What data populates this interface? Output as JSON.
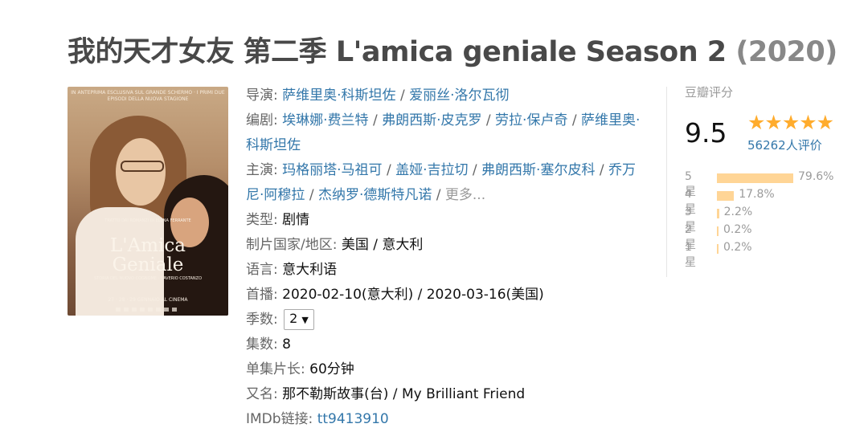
{
  "title": {
    "main": "我的天才女友 第二季 L'amica geniale Season 2",
    "year": "(2020)"
  },
  "poster": {
    "top_text": "IN ANTEPRIMA ESCLUSIVA SUL GRANDE SCHERMO · I PRIMI DUE EPISODI DELLA NUOVA STAGIONE",
    "author_text": "TRATTO DAI ROMANZI DI ELENA FERRANTE",
    "title_line1": "L'Amica",
    "title_line2": "Geniale",
    "subtitle": "STORIA DEL NUOVO COGNOME · SAVERIO COSTANZO",
    "dates": "27 · 28 · 29 GENNAIO AL CINEMA"
  },
  "info": {
    "director": {
      "label": "导演",
      "names": [
        "萨维里奥·科斯坦佐",
        "爱丽丝·洛尔瓦彻"
      ]
    },
    "writer": {
      "label": "编剧",
      "names": [
        "埃琳娜·费兰特",
        "弗朗西斯·皮克罗",
        "劳拉·保卢奇",
        "萨维里奥·科斯坦佐"
      ]
    },
    "cast": {
      "label": "主演",
      "names": [
        "玛格丽塔·马祖可",
        "盖娅·吉拉切",
        "弗朗西斯·塞尔皮科",
        "乔万尼·阿穆拉",
        "杰纳罗·德斯特凡诺"
      ],
      "more": "更多..."
    },
    "genre": {
      "label": "类型:",
      "value": "剧情"
    },
    "country": {
      "label": "制片国家/地区:",
      "value": "美国 / 意大利"
    },
    "language": {
      "label": "语言:",
      "value": "意大利语"
    },
    "premiere": {
      "label": "首播:",
      "value": "2020-02-10(意大利) / 2020-03-16(美国)"
    },
    "season": {
      "label": "季数:",
      "value": "2"
    },
    "episodes": {
      "label": "集数:",
      "value": "8"
    },
    "runtime": {
      "label": "单集片长:",
      "value": "60分钟"
    },
    "aka": {
      "label": "又名:",
      "value": "那不勒斯故事(台) / My Brilliant Friend"
    },
    "imdb": {
      "label": "IMDb链接:",
      "value": "tt9413910"
    }
  },
  "rating": {
    "label": "豆瓣评分",
    "score": "9.5",
    "stars": "★★★★★",
    "count": "56262人评价",
    "star_color": "#ffac2d",
    "bar_color": "#ffd596",
    "breakdown": [
      {
        "label": "5星",
        "percent": 79.6,
        "text": "79.6%"
      },
      {
        "label": "4星",
        "percent": 17.8,
        "text": "17.8%"
      },
      {
        "label": "3星",
        "percent": 2.2,
        "text": "2.2%"
      },
      {
        "label": "2星",
        "percent": 0.2,
        "text": "0.2%"
      },
      {
        "label": "1星",
        "percent": 0.2,
        "text": "0.2%"
      }
    ]
  }
}
